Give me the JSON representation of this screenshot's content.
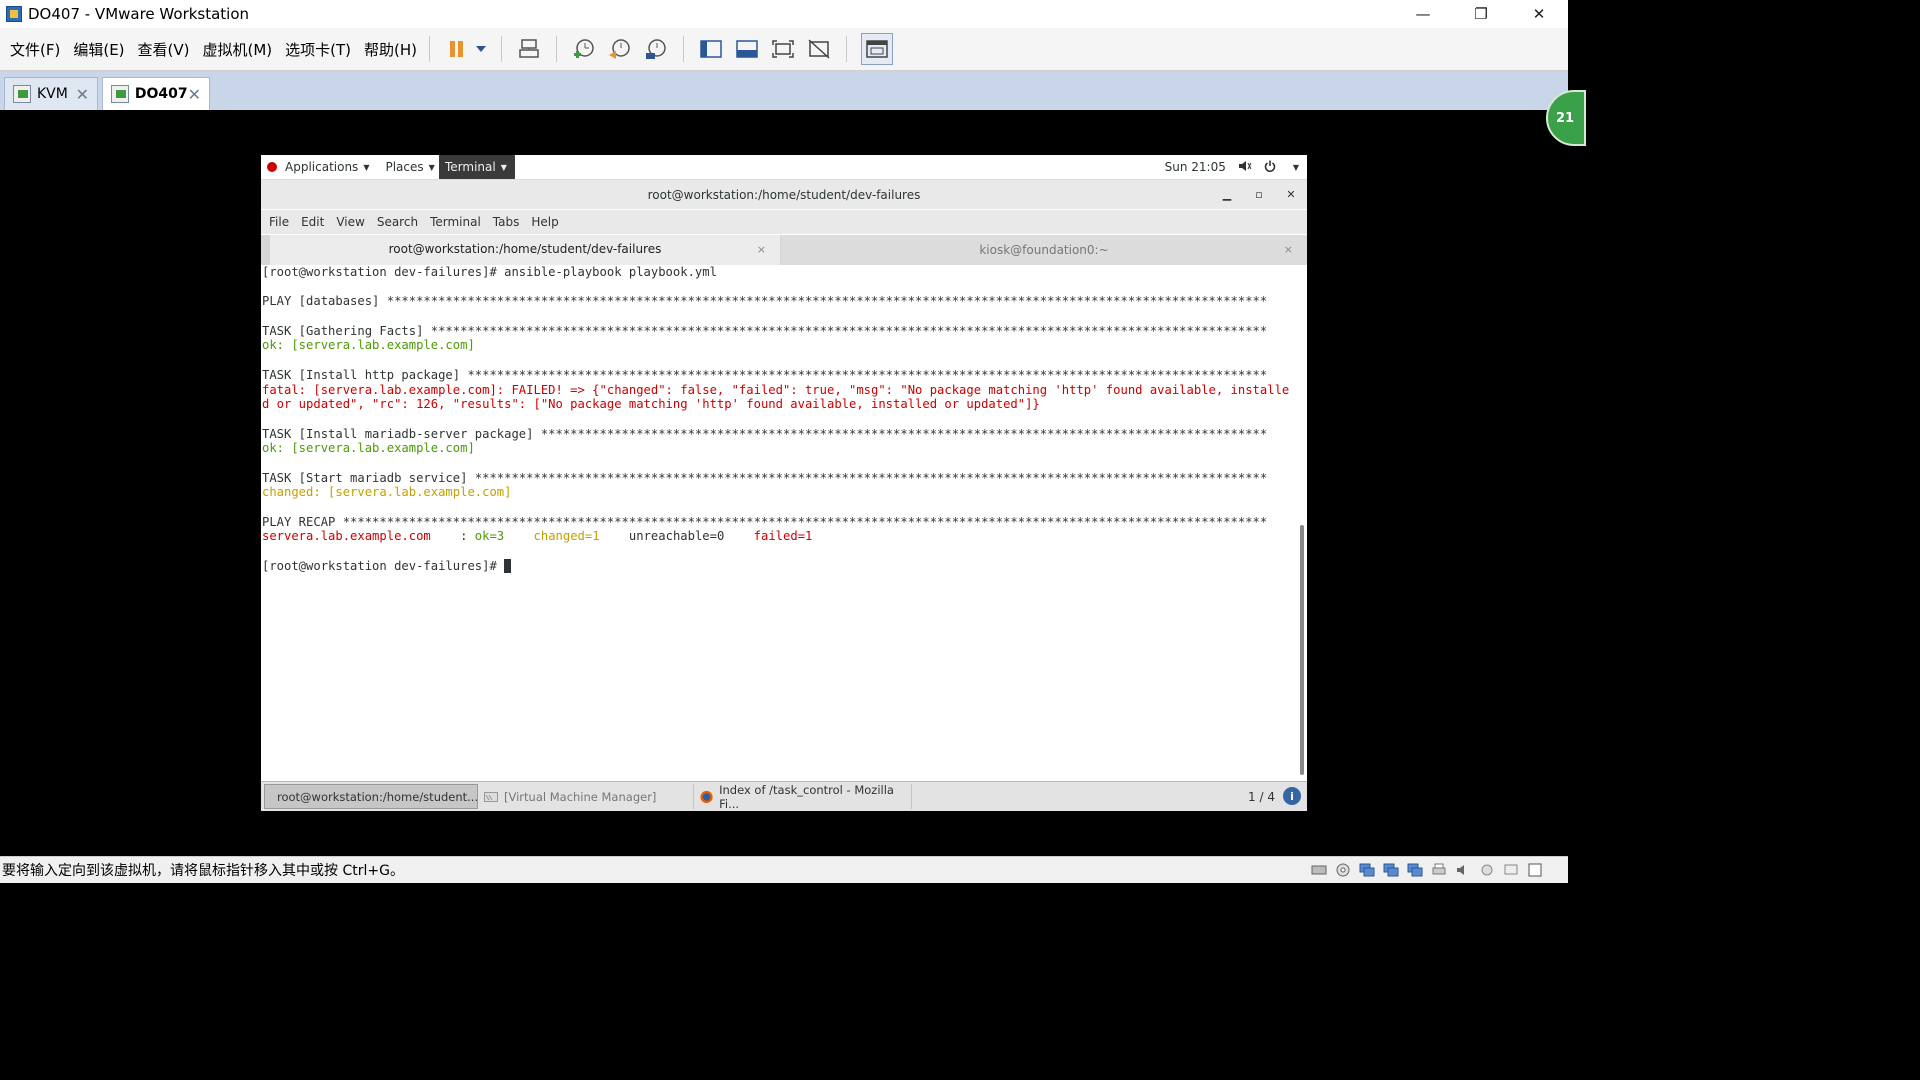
{
  "window": {
    "title": "DO407 - VMware Workstation",
    "controls": {
      "minimize": "—",
      "restore": "❐",
      "close": "✕"
    }
  },
  "menu": [
    "文件(F)",
    "编辑(E)",
    "查看(V)",
    "虚拟机(M)",
    "选项卡(T)",
    "帮助(H)"
  ],
  "toolbar_icons": [
    "pause-icon",
    "dropdown-icon",
    "send-keys-icon",
    "snapshot-take-icon",
    "snapshot-revert-icon",
    "snapshot-manager-icon",
    "sidebar-toggle-icon",
    "console-view-icon",
    "fullscreen-icon",
    "unity-icon",
    "thumbnail-view-icon"
  ],
  "tabs": [
    {
      "label": "KVM",
      "close": "✕"
    },
    {
      "label": "DO407",
      "close": "✕"
    }
  ],
  "notification": {
    "text": "21"
  },
  "gnome": {
    "applications": "Applications",
    "places": "Places",
    "terminal": "Terminal",
    "clock": "Sun 21:05"
  },
  "terminal": {
    "title": "root@workstation:/home/student/dev-failures",
    "menu": [
      "File",
      "Edit",
      "View",
      "Search",
      "Terminal",
      "Tabs",
      "Help"
    ],
    "tabs": [
      {
        "label": "root@workstation:/home/student/dev-failures",
        "close": "×"
      },
      {
        "label": "kiosk@foundation0:~",
        "close": "×"
      }
    ],
    "lines": [
      {
        "text": "[root@workstation dev-failures]# ansible-playbook playbook.yml",
        "color": "default"
      },
      {
        "text": "",
        "color": "default"
      },
      {
        "text": "PLAY [databases] ************************************************************************************************************************",
        "color": "default"
      },
      {
        "text": "",
        "color": "default"
      },
      {
        "text": "TASK [Gathering Facts] ******************************************************************************************************************",
        "color": "default"
      },
      {
        "text": "ok: [servera.lab.example.com]",
        "color": "green"
      },
      {
        "text": "",
        "color": "default"
      },
      {
        "text": "TASK [Install http package] *************************************************************************************************************",
        "color": "default"
      },
      {
        "text": "fatal: [servera.lab.example.com]: FAILED! => {\"changed\": false, \"failed\": true, \"msg\": \"No package matching 'http' found available, installe",
        "color": "red"
      },
      {
        "text": "d or updated\", \"rc\": 126, \"results\": [\"No package matching 'http' found available, installed or updated\"]}",
        "color": "red"
      },
      {
        "text": "",
        "color": "default"
      },
      {
        "text": "TASK [Install mariadb-server package] ***************************************************************************************************",
        "color": "default"
      },
      {
        "text": "ok: [servera.lab.example.com]",
        "color": "green"
      },
      {
        "text": "",
        "color": "default"
      },
      {
        "text": "TASK [Start mariadb service] ************************************************************************************************************",
        "color": "default"
      },
      {
        "text": "changed: [servera.lab.example.com]",
        "color": "yellow"
      },
      {
        "text": "",
        "color": "default"
      },
      {
        "text": "PLAY RECAP ******************************************************************************************************************************",
        "color": "default"
      }
    ],
    "recap": {
      "host": "servera.lab.example.com",
      "sep": "    : ",
      "ok": "ok=3",
      "changed": "changed=1",
      "unreachable": "unreachable=0",
      "failed": "failed=1"
    },
    "prompt": "[root@workstation dev-failures]# "
  },
  "guest_taskbar": {
    "items": [
      "root@workstation:/home/student...",
      "[Virtual Machine Manager]",
      "Index of /task_control - Mozilla Fi..."
    ],
    "pager": "1 / 4",
    "info": "i"
  },
  "statusbar": {
    "text": "要将输入定向到该虚拟机，请将鼠标指针移入其中或按 Ctrl+G。"
  },
  "colors": {
    "term_green": "#4e9a06",
    "term_red": "#cc0000",
    "term_yellow": "#c4a000",
    "vm_tab_bar": "#c9d6ea"
  }
}
